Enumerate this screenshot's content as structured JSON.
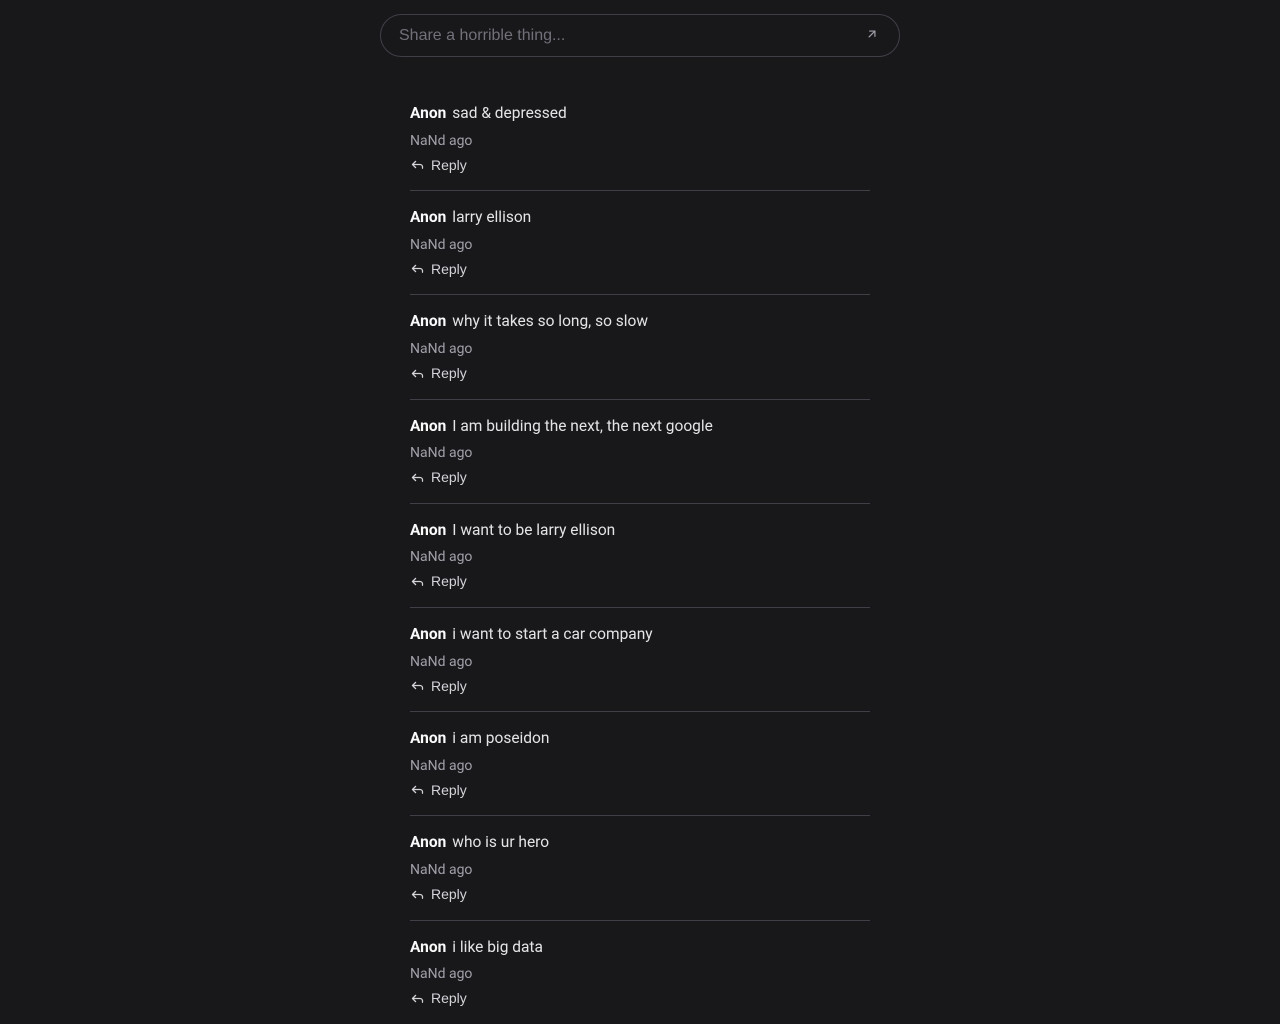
{
  "composer": {
    "placeholder": "Share a horrible thing...",
    "submit_icon": "arrow-up-right"
  },
  "labels": {
    "reply": "Reply"
  },
  "posts": [
    {
      "author": "Anon",
      "content": "sad & depressed",
      "timestamp": "NaNd ago"
    },
    {
      "author": "Anon",
      "content": "larry ellison",
      "timestamp": "NaNd ago"
    },
    {
      "author": "Anon",
      "content": "why it takes so long, so slow",
      "timestamp": "NaNd ago"
    },
    {
      "author": "Anon",
      "content": "I am building the next, the next google",
      "timestamp": "NaNd ago"
    },
    {
      "author": "Anon",
      "content": "I want to be larry ellison",
      "timestamp": "NaNd ago"
    },
    {
      "author": "Anon",
      "content": "i want to start a car company",
      "timestamp": "NaNd ago"
    },
    {
      "author": "Anon",
      "content": "i am poseidon",
      "timestamp": "NaNd ago"
    },
    {
      "author": "Anon",
      "content": "who is ur hero",
      "timestamp": "NaNd ago"
    },
    {
      "author": "Anon",
      "content": "i like big data",
      "timestamp": "NaNd ago"
    }
  ]
}
